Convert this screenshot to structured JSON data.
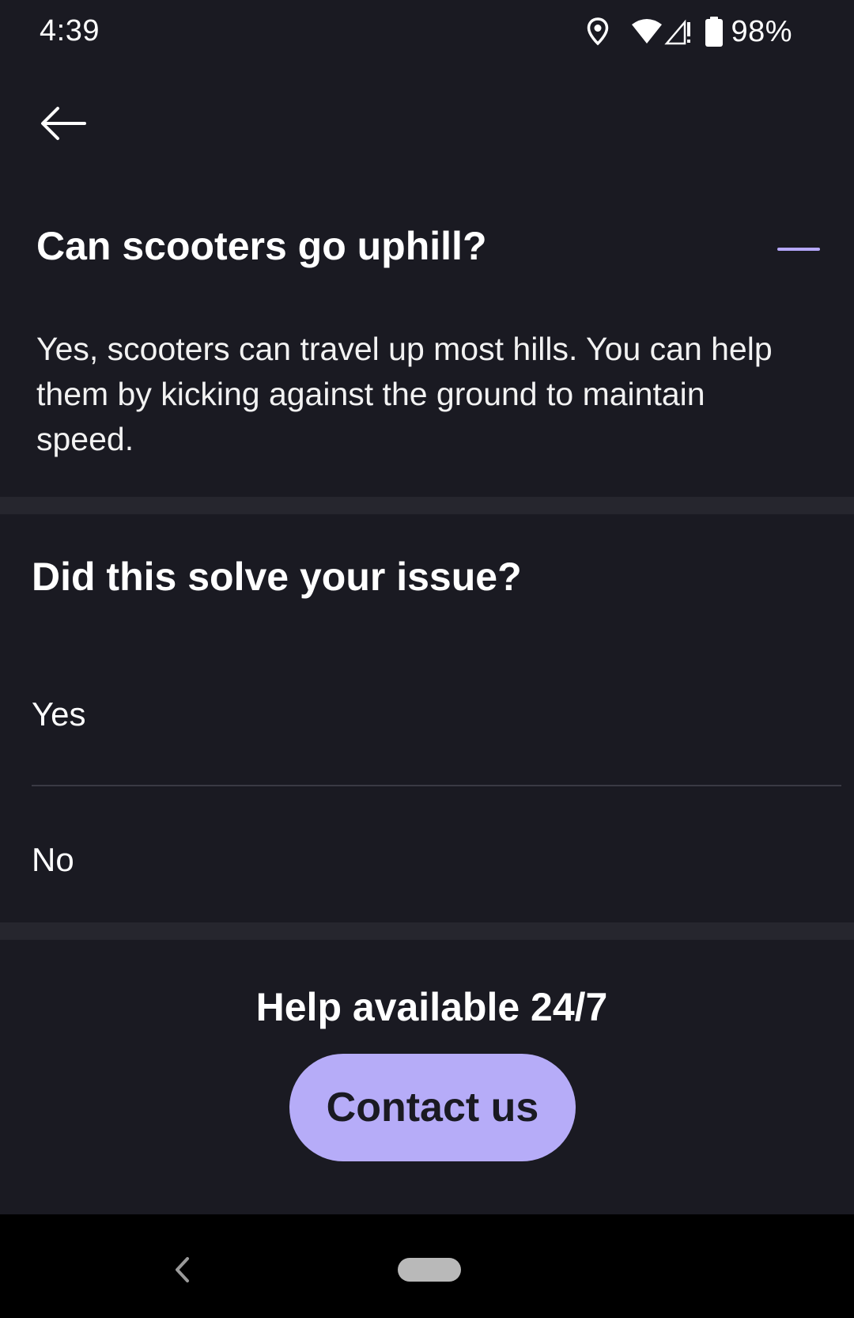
{
  "status_bar": {
    "time": "4:39",
    "battery_percent": "98%",
    "icons": [
      "location-icon",
      "wifi-icon",
      "cellular-signal-icon",
      "battery-icon"
    ]
  },
  "header": {
    "back_icon": "arrow-left-icon"
  },
  "faq": {
    "question": "Can scooters go uphill?",
    "answer": "Yes, scooters can travel up most hills. You can help them by kicking against the ground to maintain speed.",
    "toggle_icon": "minus-icon",
    "accent_color": "#b6a8ff"
  },
  "feedback": {
    "title": "Did this solve your issue?",
    "options": [
      {
        "label": "Yes"
      },
      {
        "label": "No"
      }
    ]
  },
  "help": {
    "title": "Help available 24/7",
    "contact_button": "Contact us",
    "button_color": "#b6acf8"
  },
  "nav_bar": {
    "icons": [
      "nav-back-icon",
      "nav-home-pill"
    ]
  }
}
